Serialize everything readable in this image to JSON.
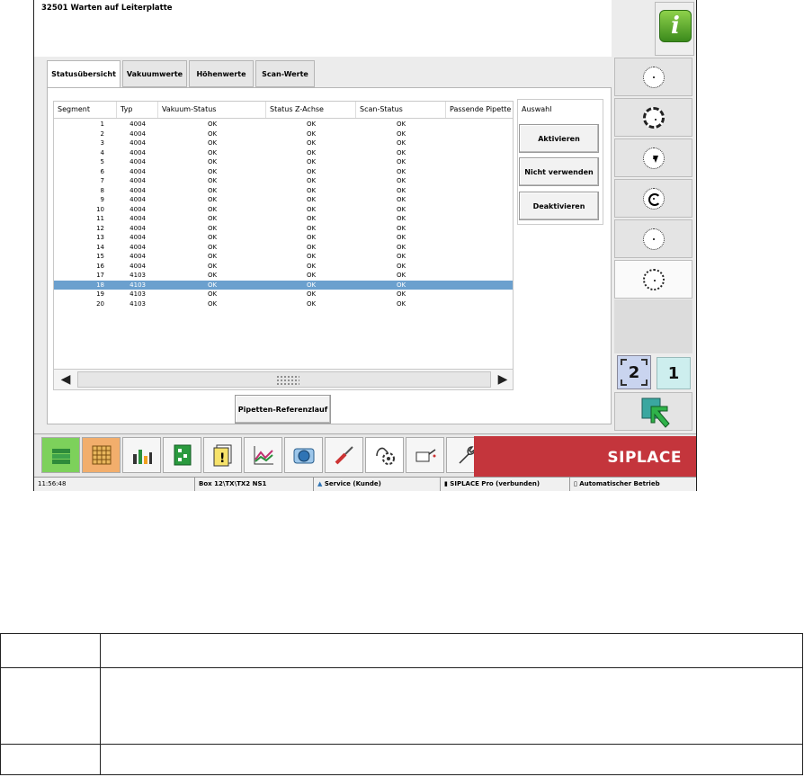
{
  "title": "32501 Warten auf Leiterplatte",
  "tabs": [
    {
      "label": "Statusübersicht",
      "active": true
    },
    {
      "label": "Vakuumwerte",
      "active": false
    },
    {
      "label": "Höhenwerte",
      "active": false
    },
    {
      "label": "Scan-Werte",
      "active": false
    }
  ],
  "table": {
    "columns": [
      "Segment",
      "Typ",
      "Vakuum-Status",
      "Status Z-Achse",
      "Scan-Status",
      "Passende Pipette"
    ],
    "rows": [
      [
        "1",
        "4004",
        "OK",
        "OK",
        "OK",
        ""
      ],
      [
        "2",
        "4004",
        "OK",
        "OK",
        "OK",
        ""
      ],
      [
        "3",
        "4004",
        "OK",
        "OK",
        "OK",
        ""
      ],
      [
        "4",
        "4004",
        "OK",
        "OK",
        "OK",
        ""
      ],
      [
        "5",
        "4004",
        "OK",
        "OK",
        "OK",
        ""
      ],
      [
        "6",
        "4004",
        "OK",
        "OK",
        "OK",
        ""
      ],
      [
        "7",
        "4004",
        "OK",
        "OK",
        "OK",
        ""
      ],
      [
        "8",
        "4004",
        "OK",
        "OK",
        "OK",
        ""
      ],
      [
        "9",
        "4004",
        "OK",
        "OK",
        "OK",
        ""
      ],
      [
        "10",
        "4004",
        "OK",
        "OK",
        "OK",
        ""
      ],
      [
        "11",
        "4004",
        "OK",
        "OK",
        "OK",
        ""
      ],
      [
        "12",
        "4004",
        "OK",
        "OK",
        "OK",
        ""
      ],
      [
        "13",
        "4004",
        "OK",
        "OK",
        "OK",
        ""
      ],
      [
        "14",
        "4004",
        "OK",
        "OK",
        "OK",
        ""
      ],
      [
        "15",
        "4004",
        "OK",
        "OK",
        "OK",
        ""
      ],
      [
        "16",
        "4004",
        "OK",
        "OK",
        "OK",
        ""
      ],
      [
        "17",
        "4103",
        "OK",
        "OK",
        "OK",
        ""
      ],
      [
        "18",
        "4103",
        "OK",
        "OK",
        "OK",
        ""
      ],
      [
        "19",
        "4103",
        "OK",
        "OK",
        "OK",
        ""
      ],
      [
        "20",
        "4103",
        "OK",
        "OK",
        "OK",
        ""
      ]
    ],
    "selected_row_index": 17
  },
  "selection_panel": {
    "label": "Auswahl",
    "buttons": [
      "Aktivieren",
      "Nicht verwenden",
      "Deaktivieren"
    ]
  },
  "reference_button": "Pipetten-Referenzlauf",
  "side_buttons": [
    {
      "icon": "dial-icon"
    },
    {
      "icon": "gear-dial-icon"
    },
    {
      "icon": "dial-down-icon"
    },
    {
      "icon": "dial-rotate-icon"
    },
    {
      "icon": "dial-search-icon"
    },
    {
      "icon": "dial-dotted-icon",
      "selected": true
    }
  ],
  "page_indicator": {
    "left": "2",
    "right": "1"
  },
  "taskbar_icons": [
    "money-stack-icon",
    "grid-chart-icon",
    "bar-chart-icon",
    "circuit-board-icon",
    "warning-document-icon",
    "trend-chart-icon",
    "camera-icon",
    "screwdriver-icon",
    "hand-gear-icon",
    "oilcan-icon",
    "wrench-icon"
  ],
  "brand": "SIPLACE",
  "statusbar": {
    "time": "11:56:48",
    "location": "Box 12\\TX\\TX2 NS1",
    "mode": "Service (Kunde)",
    "connection": "SIPLACE Pro (verbunden)",
    "operation": "Automatischer Betrieb"
  },
  "colors": {
    "selected_row": "#6ba0ce",
    "brand": "#c4353c",
    "info_green": "#3b8a1c"
  }
}
